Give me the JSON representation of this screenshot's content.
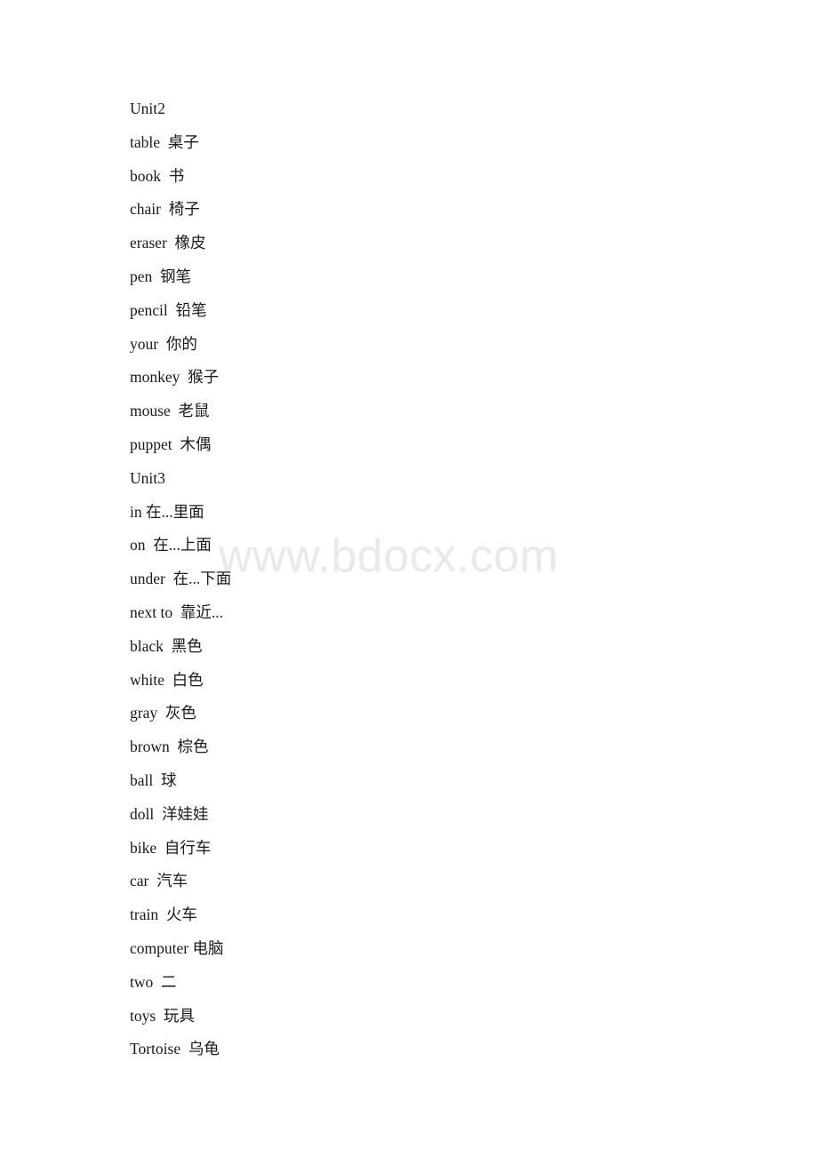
{
  "document": {
    "type": "vocabulary-list",
    "background_color": "#ffffff",
    "text_color": "#1a1a1a"
  },
  "watermark": {
    "text": "www.bdocx.com",
    "color": "#e9e9e9"
  },
  "lines": [
    {
      "text": "Unit2"
    },
    {
      "text": "table  桌子"
    },
    {
      "text": "book  书"
    },
    {
      "text": "chair  椅子"
    },
    {
      "text": "eraser  橡皮"
    },
    {
      "text": "pen  钢笔"
    },
    {
      "text": "pencil  铅笔"
    },
    {
      "text": "your  你的"
    },
    {
      "text": "monkey  猴子"
    },
    {
      "text": "mouse  老鼠"
    },
    {
      "text": "puppet  木偶"
    },
    {
      "text": "Unit3"
    },
    {
      "text": "in 在...里面"
    },
    {
      "text": "on  在...上面"
    },
    {
      "text": "under  在...下面"
    },
    {
      "text": "next to  靠近..."
    },
    {
      "text": "black  黑色"
    },
    {
      "text": "white  白色"
    },
    {
      "text": "gray  灰色"
    },
    {
      "text": "brown  棕色"
    },
    {
      "text": "ball  球"
    },
    {
      "text": "doll  洋娃娃"
    },
    {
      "text": "bike  自行车"
    },
    {
      "text": "car  汽车"
    },
    {
      "text": "train  火车"
    },
    {
      "text": "computer 电脑"
    },
    {
      "text": "two  二"
    },
    {
      "text": "toys  玩具"
    },
    {
      "text": "Tortoise  乌龟"
    }
  ]
}
